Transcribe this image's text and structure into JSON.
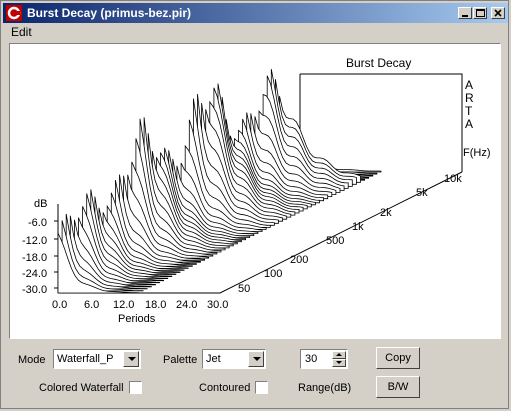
{
  "window": {
    "title": "Burst Decay  (primus-bez.pir)"
  },
  "menu": {
    "items": [
      "Edit"
    ]
  },
  "chart_data": {
    "type": "waterfall",
    "title": "Burst Decay",
    "side_label": [
      "A",
      "R",
      "T",
      "A"
    ],
    "zlabel": "dB",
    "z_ticks": [
      "-6.0",
      "-12.0",
      "-18.0",
      "-24.0",
      "-30.0"
    ],
    "xlabel": "Periods",
    "x_ticks": [
      "0.0",
      "6.0",
      "12.0",
      "18.0",
      "24.0",
      "30.0"
    ],
    "ylabel": "F(Hz)",
    "y_ticks": [
      "50",
      "100",
      "200",
      "500",
      "1k",
      "2k",
      "5k",
      "10k"
    ],
    "zlim": [
      -30,
      0
    ],
    "xlim": [
      0,
      30
    ]
  },
  "controls": {
    "mode_label": "Mode",
    "mode_value": "Waterfall_P",
    "palette_label": "Palette",
    "palette_value": "Jet",
    "range_value": "30",
    "range_label": "Range(dB)",
    "copy_label": "Copy",
    "bw_label": "B/W",
    "colored_waterfall_label": "Colored Waterfall",
    "contoured_label": "Contoured"
  }
}
